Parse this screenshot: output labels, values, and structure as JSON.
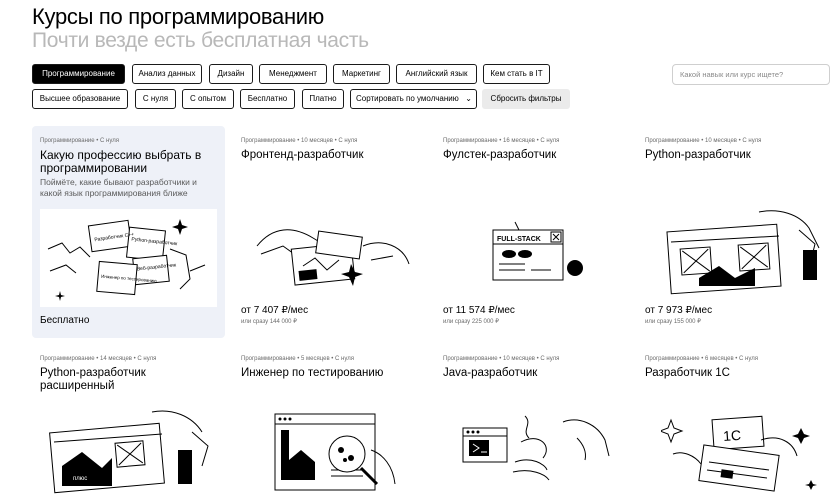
{
  "header": {
    "title": "Курсы по программированию",
    "subtitle": "Почти везде есть бесплатная часть"
  },
  "filters": {
    "row1": [
      "Программирование",
      "Анализ данных",
      "Дизайн",
      "Менеджмент",
      "Маркетинг",
      "Английский язык",
      "Кем стать в IT"
    ],
    "row2": [
      "Высшее образование",
      "С нуля",
      "С опытом",
      "Бесплатно",
      "Платно"
    ],
    "active": "Программирование",
    "sort_label": "Сортировать по умолчанию",
    "reset_label": "Сбросить фильтры"
  },
  "search": {
    "placeholder": "Какой навык или курс ищете?"
  },
  "cards": [
    {
      "meta": "Программирование • С нуля",
      "title": "Какую профессию выбрать в программировании",
      "desc": "Поймёте, какие бывают разработчики и какой язык программирования ближе",
      "free": "Бесплатно"
    },
    {
      "meta": "Программирование • 10 месяцев • С нуля",
      "title": "Фронтенд-разработчик",
      "price": "от 7 407 ₽/мес",
      "price_sub": "или сразу 144 000 ₽"
    },
    {
      "meta": "Программирование • 16 месяцев • С нуля",
      "title": "Фулстек-разработчик",
      "price": "от 11 574 ₽/мес",
      "price_sub": "или сразу 225 000 ₽",
      "illus_text": "FULL-STACK"
    },
    {
      "meta": "Программирование • 10 месяцев • С нуля",
      "title": "Python-разработчик",
      "price": "от 7 973 ₽/мес",
      "price_sub": "или сразу 155 000 ₽"
    },
    {
      "meta": "Программирование • 14 месяцев • С нуля",
      "title": "Python-разработчик расширенный",
      "badge": "плюс"
    },
    {
      "meta": "Программирование • 5 месяцев • С нуля",
      "title": "Инженер по тестированию"
    },
    {
      "meta": "Программирование • 10 месяцев • С нуля",
      "title": "Java-разработчик"
    },
    {
      "meta": "Программирование • 6 месяцев • С нуля",
      "title": "Разработчик 1С",
      "illus_text": "1C"
    }
  ],
  "featured_illus": {
    "note1": "Разработчик C++",
    "note2": "Python-разработчик",
    "note3": "Веб-разработчик",
    "note4": "Инженер по тестированию"
  }
}
